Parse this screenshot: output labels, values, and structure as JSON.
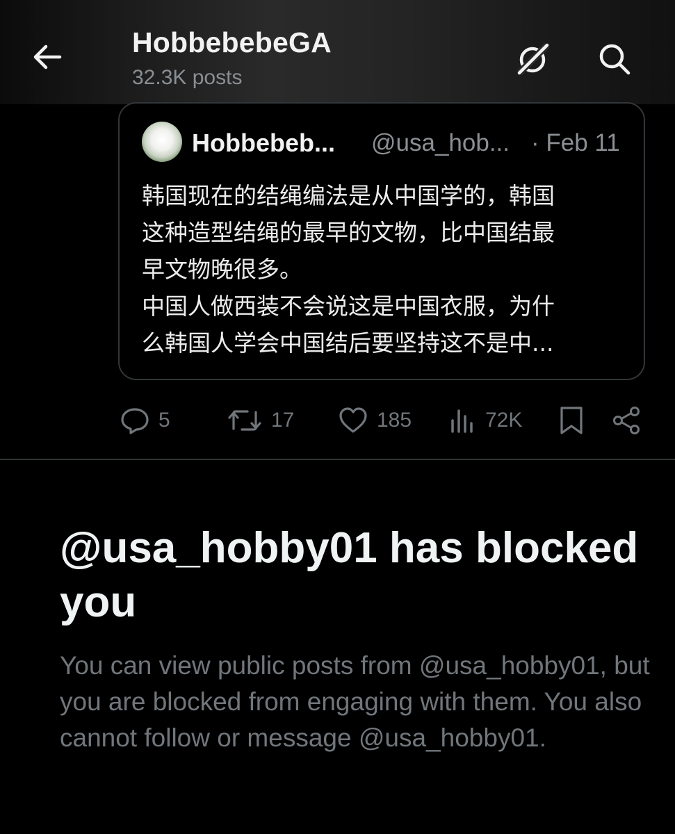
{
  "header": {
    "title": "HobbebebeGA",
    "subtitle": "32.3K posts"
  },
  "quote": {
    "author_name": "Hobbebeb...",
    "author_handle": "@usa_hob...",
    "date": "· Feb 11",
    "body_lines": [
      "韩国现在的结绳编法是从中国学的，韩国",
      "这种造型结绳的最早的文物，比中国结最",
      "早文物晚很多。",
      "中国人做西装不会说这是中国衣服，为什",
      "么韩国人学会中国结后要坚持这不是中..."
    ]
  },
  "actions": {
    "replies": "5",
    "reposts": "17",
    "likes": "185",
    "views": "72K"
  },
  "notice": {
    "title": "@usa_hobby01 has blocked you",
    "description": "You can view public posts from @usa_hobby01, but you are blocked from engaging with them. You also cannot follow or message @usa_hobby01."
  },
  "colors": {
    "background": "#000000",
    "text_primary": "#e7e9ea",
    "text_secondary": "#71767b",
    "border": "#333639"
  }
}
